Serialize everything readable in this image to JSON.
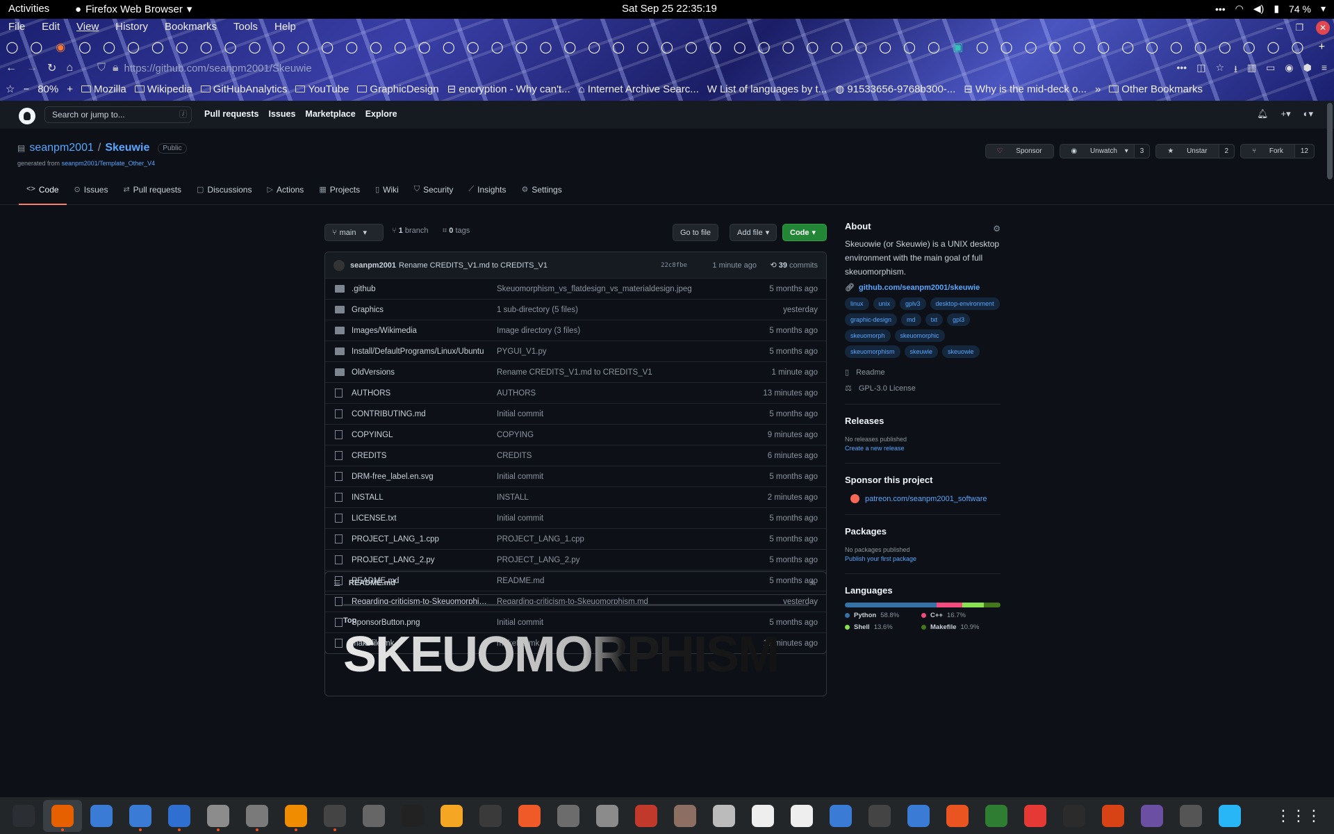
{
  "system_bar": {
    "activities": "Activities",
    "browser": "Firefox Web Browser",
    "clock": "Sat Sep 25  22:35:19",
    "battery": "74 %"
  },
  "firefox": {
    "menu": [
      "File",
      "Edit",
      "View",
      "History",
      "Bookmarks",
      "Tools",
      "Help"
    ],
    "url_prefix": "https://github.com/",
    "url_path": "seanpm2001/Skeuwie",
    "zoom": "80%",
    "bookmarks": [
      "Mozilla",
      "Wikipedia",
      "GitHubAnalytics",
      "YouTube",
      "GraphicDesign",
      "encryption - Why can't...",
      "Internet Archive Searc...",
      "List of languages by t...",
      "91533656-9768b300-...",
      "Why is the mid-deck o..."
    ],
    "other_bookmarks": "Other Bookmarks"
  },
  "gh_header": {
    "search_placeholder": "Search or jump to...",
    "search_key": "/",
    "nav": [
      "Pull requests",
      "Issues",
      "Marketplace",
      "Explore"
    ]
  },
  "repo": {
    "owner": "seanpm2001",
    "name": "Skeuwie",
    "visibility": "Public",
    "generated_label": "generated from",
    "generated_from": "seanpm2001/Template_Other_V4",
    "sponsor": "Sponsor",
    "unwatch": "Unwatch",
    "watch_count": "3",
    "unstar": "Unstar",
    "star_count": "2",
    "fork": "Fork",
    "fork_count": "12",
    "tabs": [
      "Code",
      "Issues",
      "Pull requests",
      "Discussions",
      "Actions",
      "Projects",
      "Wiki",
      "Security",
      "Insights",
      "Settings"
    ]
  },
  "code": {
    "branch": "main",
    "branches_num": "1",
    "branches_label": "branch",
    "tags_num": "0",
    "tags_label": "tags",
    "go_to_file": "Go to file",
    "add_file": "Add file",
    "code_btn": "Code",
    "commit": {
      "author": "seanpm2001",
      "message": "Rename CREDITS_V1.md to CREDITS_V1",
      "sha": "22c8fbe",
      "age": "1 minute ago",
      "count": "39",
      "count_label": "commits"
    },
    "files": [
      {
        "type": "dir",
        "name": ".github",
        "msg": "Skeuomorphism_vs_flatdesign_vs_materialdesign.jpeg",
        "age": "5 months ago"
      },
      {
        "type": "dir",
        "name": "Graphics",
        "msg": "1 sub-directory (5 files)",
        "age": "yesterday"
      },
      {
        "type": "dir",
        "name": "Images/Wikimedia",
        "msg": "Image directory (3 files)",
        "age": "5 months ago"
      },
      {
        "type": "dir",
        "name": "Install/DefaultPrograms/Linux/Ubuntu",
        "msg": "PYGUI_V1.py",
        "age": "5 months ago"
      },
      {
        "type": "dir",
        "name": "OldVersions",
        "msg": "Rename CREDITS_V1.md to CREDITS_V1",
        "age": "1 minute ago"
      },
      {
        "type": "file",
        "name": "AUTHORS",
        "msg": "AUTHORS",
        "age": "13 minutes ago"
      },
      {
        "type": "file",
        "name": "CONTRIBUTING.md",
        "msg": "Initial commit",
        "age": "5 months ago"
      },
      {
        "type": "file",
        "name": "COPYINGL",
        "msg": "COPYING",
        "age": "9 minutes ago"
      },
      {
        "type": "file",
        "name": "CREDITS",
        "msg": "CREDITS",
        "age": "6 minutes ago"
      },
      {
        "type": "file",
        "name": "DRM-free_label.en.svg",
        "msg": "Initial commit",
        "age": "5 months ago"
      },
      {
        "type": "file",
        "name": "INSTALL",
        "msg": "INSTALL",
        "age": "2 minutes ago"
      },
      {
        "type": "file",
        "name": "LICENSE.txt",
        "msg": "Initial commit",
        "age": "5 months ago"
      },
      {
        "type": "file",
        "name": "PROJECT_LANG_1.cpp",
        "msg": "PROJECT_LANG_1.cpp",
        "age": "5 months ago"
      },
      {
        "type": "file",
        "name": "PROJECT_LANG_2.py",
        "msg": "PROJECT_LANG_2.py",
        "age": "5 months ago"
      },
      {
        "type": "file",
        "name": "README.md",
        "msg": "README.md",
        "age": "5 months ago"
      },
      {
        "type": "file",
        "name": "Regarding-criticism-to-Skeuomorphis...",
        "msg": "Regarding-criticism-to-Skeuomorphism.md",
        "age": "yesterday"
      },
      {
        "type": "file",
        "name": "SponsorButton.png",
        "msg": "Initial commit",
        "age": "5 months ago"
      },
      {
        "type": "file",
        "name": "makefile.mk",
        "msg": "makefile.mk",
        "age": "12 minutes ago"
      }
    ],
    "readme_title": "README.md",
    "readme_top": "Top",
    "readme_banner": "SKEUOMORPHISM"
  },
  "sidebar": {
    "about_title": "About",
    "description": "Skeuowie (or Skeuwie) is a UNIX desktop environment with the main goal of full skeuomorphism.",
    "link": "github.com/seanpm2001/skeuwie",
    "topics": [
      "linux",
      "unix",
      "gplv3",
      "desktop-environment",
      "graphic-design",
      "md",
      "txt",
      "gpl3",
      "skeuomorph",
      "skeuomorphic",
      "skeuomorphism",
      "skeuwie",
      "skeuowie"
    ],
    "readme": "Readme",
    "license": "GPL-3.0 License",
    "releases_title": "Releases",
    "releases_none": "No releases published",
    "releases_link": "Create a new release",
    "sponsor_title": "Sponsor this project",
    "sponsor_link": "patreon.com/seanpm2001_software",
    "packages_title": "Packages",
    "packages_none": "No packages published",
    "packages_link": "Publish your first package",
    "languages_title": "Languages",
    "languages": [
      {
        "name": "Python",
        "pct": "58.8%",
        "value": 58.8,
        "color": "#3572A5"
      },
      {
        "name": "C++",
        "pct": "16.7%",
        "value": 16.7,
        "color": "#f34b7d"
      },
      {
        "name": "Shell",
        "pct": "13.6%",
        "value": 13.6,
        "color": "#89e051"
      },
      {
        "name": "Makefile",
        "pct": "10.9%",
        "value": 10.9,
        "color": "#427819"
      }
    ]
  },
  "dock_apps": [
    "system-monitor",
    "firefox",
    "text-editor",
    "help",
    "notes",
    "files",
    "settings",
    "vlc",
    "terminal-game",
    "inkscape",
    "terminal",
    "calculator",
    "charts",
    "software",
    "image-viewer",
    "disks",
    "librecalc-like",
    "document",
    "archive",
    "char-map",
    "dictionary",
    "tasks",
    "vim",
    "screen",
    "ubuntu",
    "spreadsheet",
    "error",
    "music",
    "game",
    "camera",
    "gimp",
    "calendar"
  ]
}
